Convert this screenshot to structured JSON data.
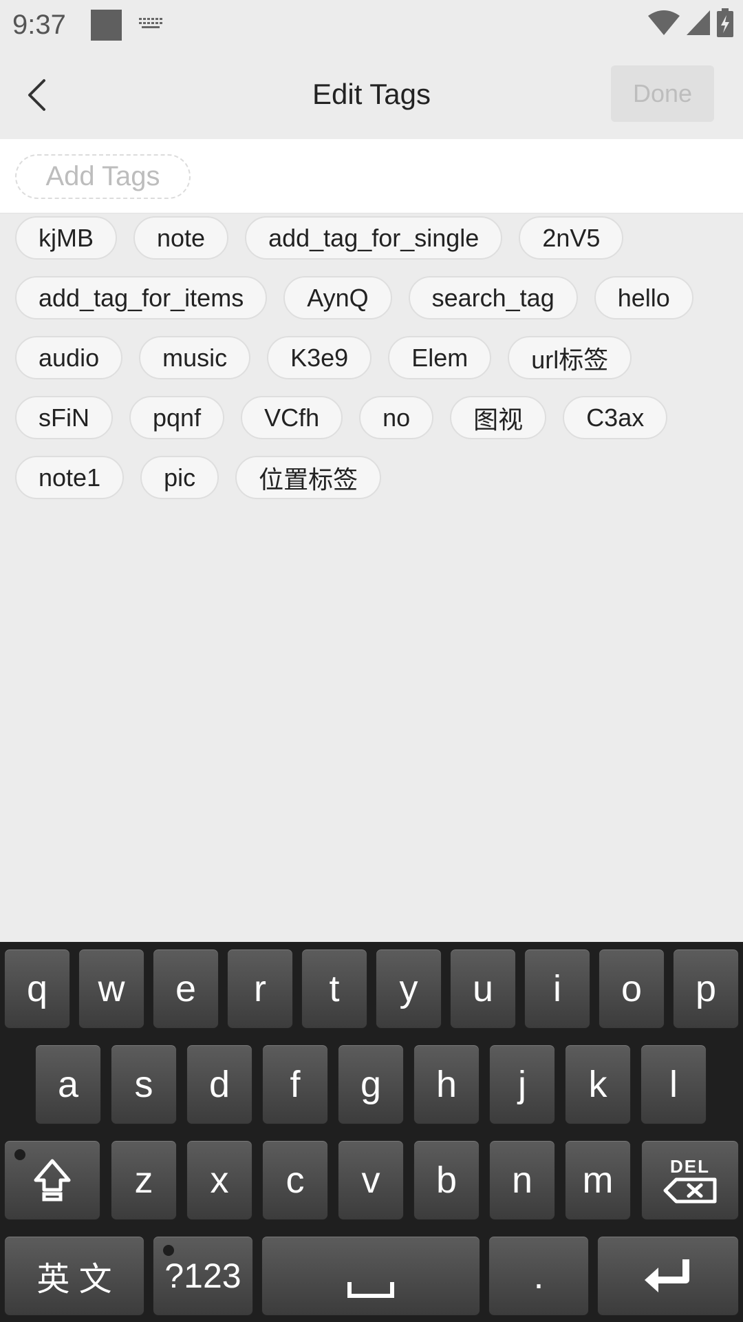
{
  "status_bar": {
    "time": "9:37"
  },
  "header": {
    "title": "Edit Tags",
    "done_label": "Done"
  },
  "input": {
    "placeholder": "Add Tags"
  },
  "tags": [
    "kjMB",
    "note",
    "add_tag_for_single",
    "2nV5",
    "add_tag_for_items",
    "AynQ",
    "search_tag",
    "hello",
    "audio",
    "music",
    "K3e9",
    "Elem",
    "url标签",
    "sFiN",
    "pqnf",
    "VCfh",
    "no",
    "图视",
    "C3ax",
    "note1",
    "pic",
    "位置标签"
  ],
  "keyboard": {
    "row1": [
      "q",
      "w",
      "e",
      "r",
      "t",
      "y",
      "u",
      "i",
      "o",
      "p"
    ],
    "row2": [
      "a",
      "s",
      "d",
      "f",
      "g",
      "h",
      "j",
      "k",
      "l"
    ],
    "row3": [
      "z",
      "x",
      "c",
      "v",
      "b",
      "n",
      "m"
    ],
    "del_label": "DEL",
    "lang_label": "英 文",
    "symbols_label": "?123",
    "period_label": "."
  }
}
